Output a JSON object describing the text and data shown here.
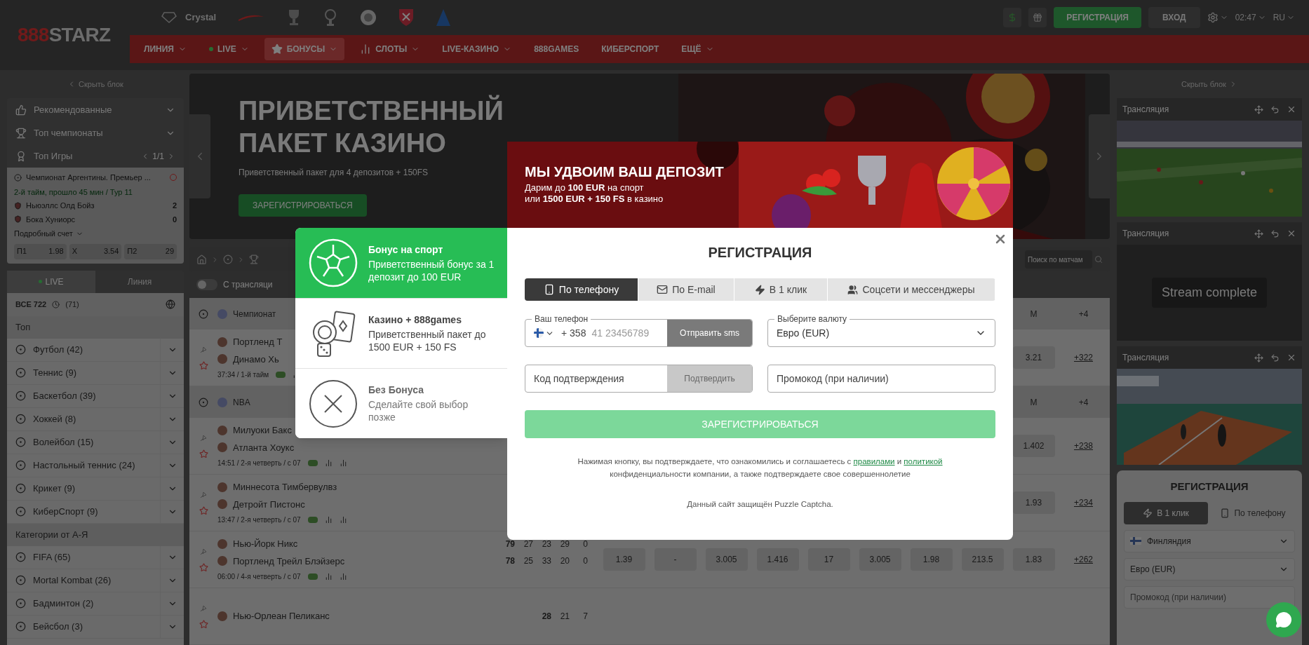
{
  "header": {
    "logo": {
      "mark": "888",
      "name": "STARZ"
    },
    "crystal_label": "Crystal",
    "register_button": "РЕГИСТРАЦИЯ",
    "login_button": "ВХОД",
    "time": "02:47",
    "language": "RU",
    "nav": [
      {
        "label": "ЛИНИЯ",
        "kind": "plain",
        "dropdown": true,
        "selected": false
      },
      {
        "label": "LIVE",
        "kind": "live",
        "dropdown": true,
        "selected": false
      },
      {
        "label": "БОНУСЫ",
        "kind": "bonus",
        "dropdown": true,
        "selected": true
      },
      {
        "label": "СЛОТЫ",
        "kind": "slots",
        "dropdown": true,
        "selected": false
      },
      {
        "label": "LIVE-КАЗИНО",
        "kind": "plain",
        "dropdown": true,
        "selected": false
      },
      {
        "label": "888GAMES",
        "kind": "plain",
        "dropdown": false,
        "selected": false
      },
      {
        "label": "КИБЕРСПОРТ",
        "kind": "plain",
        "dropdown": false,
        "selected": false
      },
      {
        "label": "ЕЩЁ",
        "kind": "plain",
        "dropdown": true,
        "selected": false
      }
    ]
  },
  "left_sidebar": {
    "hide_label": "Скрыть блок",
    "menu": [
      {
        "kind": "recommended",
        "label": "Рекомендованные"
      },
      {
        "kind": "championships",
        "label": "Топ чемпионаты"
      },
      {
        "kind": "games",
        "label": "Топ Игры",
        "pager": "1/1"
      }
    ],
    "match_card": {
      "league": "Чемпионат Аргентины. Премьер ...",
      "status": "2-й тайм, прошло 45 мин / Тур 11",
      "teams": [
        {
          "name": "Ньюэллс Олд Бойз",
          "score": "2"
        },
        {
          "name": "Бока Хуниорс",
          "score": "0"
        }
      ],
      "details": "Подробный счет",
      "odds": [
        {
          "label": "П1",
          "value": "1.98"
        },
        {
          "label": "X",
          "value": "3.54"
        },
        {
          "label": "П2",
          "value": "29"
        }
      ]
    },
    "tabs": [
      {
        "label": "LIVE",
        "selected": true
      },
      {
        "label": "Линия",
        "selected": false
      }
    ],
    "all_label": "ВСЕ 722",
    "all_count": "(71)",
    "sections": [
      {
        "title": "Топ",
        "sports": [
          "Футбол (42)",
          "Теннис (9)",
          "Баскетбол (39)",
          "Хоккей (8)",
          "Волейбол (15)",
          "Настольный теннис (24)",
          "Крикет (9)",
          "КиберСпорт (9)"
        ]
      },
      {
        "title": "Категории от А-Я",
        "sports": [
          "FIFA (65)",
          "Mortal Kombat (26)",
          "Бадминтон (2)",
          "Бейсбол (3)"
        ]
      }
    ]
  },
  "banner": {
    "title": "ПРИВЕТСТВЕННЫЙ ПАКЕТ КАЗИНО",
    "subtitle": "Приветственный пакет для 4 депозитов + 150FS",
    "button": "ЗАРЕГИСТРИРОВАТЬСЯ"
  },
  "search": {
    "placeholder": "Поиск по матчам"
  },
  "stream_toggle": {
    "label": "С трансляци",
    "on": false
  },
  "groups": [
    {
      "title": "Чемпионат",
      "columns": [
        "М",
        "+4"
      ],
      "rows": [
        {
          "teams": [
            {
              "name": "Портленд Т"
            },
            {
              "name": "Динамо Хь"
            }
          ],
          "status": "37:34 / 1-й тайм",
          "cells": [
            "3.21",
            "+322"
          ]
        }
      ]
    },
    {
      "title": "NBA",
      "columns": [
        "М",
        "+4"
      ],
      "rows": [
        {
          "teams": [
            {
              "name": "Милуоки Бакс"
            },
            {
              "name": "Атланта Хоукс"
            }
          ],
          "status": "14:51 / 2-я четверть / с 07",
          "cells": [
            "1.402",
            "+238"
          ]
        },
        {
          "teams": [
            {
              "name": "Миннесота Тимбервулвз"
            },
            {
              "name": "Детройт Пистонс"
            }
          ],
          "status": "13:47 / 2-я четверть / с 07",
          "cells": [
            "1.93",
            "+234"
          ]
        },
        {
          "teams": [
            {
              "name": "Нью-Йорк Никс",
              "scores": [
                "79",
                "27",
                "23",
                "29",
                "0"
              ]
            },
            {
              "name": "Портленд Трейл Блэйзерс",
              "scores": [
                "78",
                "25",
                "33",
                "20",
                "0"
              ]
            }
          ],
          "status": "06:00 / 4-я четверть / с 07",
          "cells": [
            "1.39",
            "-",
            "3.005",
            "1.416",
            "17",
            "3.005",
            "1.98",
            "213.5",
            "1.83",
            "+262"
          ]
        },
        {
          "teams": [
            {
              "name": "Нью-Орлеан Пеликанс",
              "scores": [
                "28",
                "21",
                "7"
              ]
            }
          ],
          "cells": []
        }
      ]
    }
  ],
  "right_sidebar": {
    "hide_label": "Скрыть блок",
    "streams": [
      {
        "title": "Трансляция",
        "kind": "pitch"
      },
      {
        "title": "Трансляция",
        "kind": "ended",
        "message": "Stream complete"
      },
      {
        "title": "Трансляция",
        "kind": "court"
      }
    ],
    "registration": {
      "title": "РЕГИСТРАЦИЯ",
      "tabs": [
        {
          "kind": "oneclick",
          "label": "В 1 клик",
          "selected": true
        },
        {
          "kind": "phone",
          "label": "По телефону",
          "selected": false
        }
      ],
      "country": "Финляндия",
      "currency": "Евро (EUR)",
      "promo_placeholder": "Промокод (при наличии)"
    }
  },
  "modal": {
    "promo": {
      "title": "МЫ УДВОИМ ВАШ ДЕПОЗИТ",
      "lines": [
        "Дарим до **100 EUR** на спорт",
        "или **1500 EUR + 150 FS** в казино"
      ]
    },
    "bonuses": [
      {
        "kind": "sport",
        "title": "Бонус на спорт",
        "text": "Приветственный бонус за 1 депозит до 100 EUR",
        "selected": true
      },
      {
        "kind": "casino",
        "title": "Казино + 888games",
        "text": "Приветственный пакет до 1500 EUR + 150 FS",
        "selected": false
      },
      {
        "kind": "none",
        "title": "Без Бонуса",
        "text": "Сделайте свой выбор позже",
        "selected": false
      }
    ],
    "title": "РЕГИСТРАЦИЯ",
    "methods": [
      {
        "kind": "phone",
        "label": "По телефону",
        "selected": true
      },
      {
        "kind": "email",
        "label": "По E-mail",
        "selected": false
      },
      {
        "kind": "oneclick",
        "label": "В 1 клик",
        "selected": false
      },
      {
        "kind": "social",
        "label": "Соцсети и мессенджеры",
        "selected": false
      }
    ],
    "phone": {
      "label": "Ваш телефон",
      "code": "+ 358",
      "placeholder": "41 23456789",
      "button": "Отправить sms"
    },
    "currency": {
      "label": "Выберите валюту",
      "value": "Евро (EUR)"
    },
    "code": {
      "placeholder": "Код подтверждения",
      "button": "Подтвердить"
    },
    "promo_code": {
      "placeholder": "Промокод (при наличии)"
    },
    "submit": {
      "label": "ЗАРЕГИСТРИРОВАТЬСЯ",
      "disabled": true
    },
    "terms": [
      {
        "kind": "text",
        "text": "Нажимая кнопку, вы подтверждаете, что ознакомились и соглашаетесь с "
      },
      {
        "kind": "link",
        "text": "правилами"
      },
      {
        "kind": "text",
        "text": " и "
      },
      {
        "kind": "link",
        "text": "политикой"
      },
      {
        "kind": "text",
        "text": "конфиденциальности компании, а также подтверждаете свое совершеннолетие",
        "newline": true
      }
    ],
    "captcha": "Данный сайт защищён Puzzle Captcha."
  }
}
